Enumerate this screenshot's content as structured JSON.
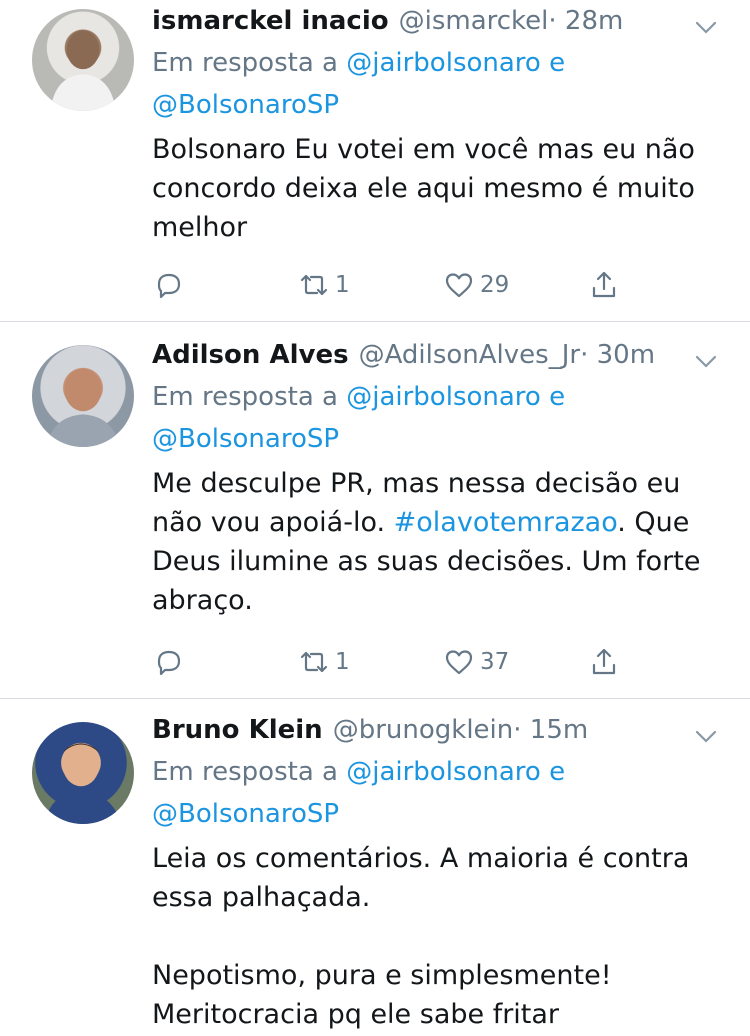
{
  "tweets": [
    {
      "name": "ismarckel inacio",
      "handle": "@ismarckel",
      "time": " · 28m",
      "reply_prefix": "Em resposta a ",
      "reply_user1": "@jairbolsonaro",
      "reply_and": " e",
      "reply_user2": "@BolsonaroSP",
      "text": "Bolsonaro Eu votei em você mas eu não concordo deixa ele aqui mesmo é muito melhor",
      "retweets": "1",
      "likes": "29"
    },
    {
      "name": "Adilson Alves",
      "handle": "@AdilsonAlves_Jr",
      "time": " · 30m",
      "reply_prefix": "Em resposta a ",
      "reply_user1": "@jairbolsonaro",
      "reply_and": " e",
      "reply_user2": "@BolsonaroSP",
      "text_before": "Me desculpe PR, mas nessa decisão eu não vou apoiá-lo. ",
      "hashtag": "#olavotemrazao",
      "text_after": ". Que Deus ilumine as suas decisões. Um forte abraço.",
      "retweets": "1",
      "likes": "37"
    },
    {
      "name": "Bruno Klein",
      "handle": "@brunogklein",
      "time": " · 15m",
      "reply_prefix": "Em resposta a ",
      "reply_user1": "@jairbolsonaro",
      "reply_and": " e",
      "reply_user2": "@BolsonaroSP",
      "text": "Leia os comentários. A maioria é contra essa palhaçada.\n\nNepotismo, pura e simplesmente!\nMeritocracia pq ele sabe fritar"
    }
  ],
  "icons": {
    "reply": "reply-icon",
    "retweet": "retweet-icon",
    "like": "heart-icon",
    "share": "share-icon",
    "caret": "chevron-down-icon"
  },
  "colors": {
    "link": "#1b95e0",
    "secondary": "#657786",
    "text": "#14171a"
  }
}
